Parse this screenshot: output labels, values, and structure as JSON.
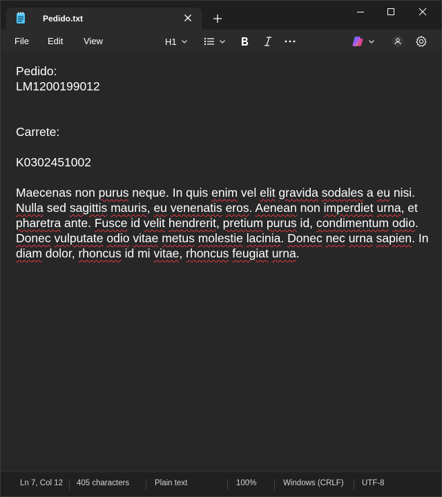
{
  "tab": {
    "title": "Pedido.txt"
  },
  "menu": {
    "file": "File",
    "edit": "Edit",
    "view": "View"
  },
  "toolbar": {
    "heading": "H1"
  },
  "document": {
    "lines": [
      "Pedido:",
      "LM1200199012",
      "",
      "",
      "Carrete:",
      "",
      "K0302451002",
      ""
    ],
    "paragraph_segments": [
      {
        "text": "Maecenas non ",
        "misspelled": false
      },
      {
        "text": "purus",
        "misspelled": true
      },
      {
        "text": " neque. In quis ",
        "misspelled": false
      },
      {
        "text": "enim",
        "misspelled": true
      },
      {
        "text": " vel ",
        "misspelled": false
      },
      {
        "text": "elit",
        "misspelled": true
      },
      {
        "text": " ",
        "misspelled": false
      },
      {
        "text": "gravida",
        "misspelled": true
      },
      {
        "text": " ",
        "misspelled": false
      },
      {
        "text": "sodales",
        "misspelled": true
      },
      {
        "text": " a ",
        "misspelled": false
      },
      {
        "text": "eu",
        "misspelled": true
      },
      {
        "text": " nisi. ",
        "misspelled": false
      },
      {
        "text": "Nulla",
        "misspelled": true
      },
      {
        "text": " sed ",
        "misspelled": false
      },
      {
        "text": "sagittis",
        "misspelled": true
      },
      {
        "text": " ",
        "misspelled": false
      },
      {
        "text": "mauris",
        "misspelled": true
      },
      {
        "text": ", ",
        "misspelled": false
      },
      {
        "text": "eu",
        "misspelled": true
      },
      {
        "text": " ",
        "misspelled": false
      },
      {
        "text": "venenatis",
        "misspelled": true
      },
      {
        "text": " ",
        "misspelled": false
      },
      {
        "text": "eros",
        "misspelled": true
      },
      {
        "text": ". ",
        "misspelled": false
      },
      {
        "text": "Aenean",
        "misspelled": true
      },
      {
        "text": " non ",
        "misspelled": false
      },
      {
        "text": "imperdiet",
        "misspelled": true
      },
      {
        "text": " ",
        "misspelled": false
      },
      {
        "text": "urna",
        "misspelled": true
      },
      {
        "text": ", et ",
        "misspelled": false
      },
      {
        "text": "pharetra",
        "misspelled": true
      },
      {
        "text": " ante. ",
        "misspelled": false
      },
      {
        "text": "Fusce",
        "misspelled": true
      },
      {
        "text": " id ",
        "misspelled": false
      },
      {
        "text": "velit",
        "misspelled": true
      },
      {
        "text": " ",
        "misspelled": false
      },
      {
        "text": "hendrerit",
        "misspelled": true
      },
      {
        "text": ", ",
        "misspelled": false
      },
      {
        "text": "pretium",
        "misspelled": true
      },
      {
        "text": " ",
        "misspelled": false
      },
      {
        "text": "purus",
        "misspelled": true
      },
      {
        "text": " id, ",
        "misspelled": false
      },
      {
        "text": "condimentum",
        "misspelled": true
      },
      {
        "text": " ",
        "misspelled": false
      },
      {
        "text": "odio",
        "misspelled": true
      },
      {
        "text": ". ",
        "misspelled": false
      },
      {
        "text": "Donec",
        "misspelled": true
      },
      {
        "text": " ",
        "misspelled": false
      },
      {
        "text": "vulputate",
        "misspelled": true
      },
      {
        "text": " ",
        "misspelled": false
      },
      {
        "text": "odio",
        "misspelled": true
      },
      {
        "text": " ",
        "misspelled": false
      },
      {
        "text": "vitae",
        "misspelled": true
      },
      {
        "text": " ",
        "misspelled": false
      },
      {
        "text": "metus",
        "misspelled": true
      },
      {
        "text": " ",
        "misspelled": false
      },
      {
        "text": "molestie",
        "misspelled": true
      },
      {
        "text": " ",
        "misspelled": false
      },
      {
        "text": "lacinia",
        "misspelled": true
      },
      {
        "text": ". ",
        "misspelled": false
      },
      {
        "text": "Donec",
        "misspelled": true
      },
      {
        "text": " ",
        "misspelled": false
      },
      {
        "text": "nec",
        "misspelled": true
      },
      {
        "text": " ",
        "misspelled": false
      },
      {
        "text": "urna",
        "misspelled": true
      },
      {
        "text": " ",
        "misspelled": false
      },
      {
        "text": "sapien",
        "misspelled": true
      },
      {
        "text": ". In ",
        "misspelled": false
      },
      {
        "text": "diam",
        "misspelled": true
      },
      {
        "text": " dolor, ",
        "misspelled": false
      },
      {
        "text": "rhoncus",
        "misspelled": true
      },
      {
        "text": " id mi ",
        "misspelled": false
      },
      {
        "text": "vitae",
        "misspelled": true
      },
      {
        "text": ", ",
        "misspelled": false
      },
      {
        "text": "rhoncus",
        "misspelled": true
      },
      {
        "text": " ",
        "misspelled": false
      },
      {
        "text": "feugiat",
        "misspelled": true
      },
      {
        "text": " ",
        "misspelled": false
      },
      {
        "text": "urna",
        "misspelled": true
      },
      {
        "text": ".",
        "misspelled": false
      }
    ]
  },
  "status": {
    "position": "Ln 7, Col 12",
    "characters": "405 characters",
    "format": "Plain text",
    "zoom": "100%",
    "line_ending": "Windows (CRLF)",
    "encoding": "UTF-8"
  },
  "colors": {
    "squiggle": "#e0383e",
    "editor_bg": "#272727",
    "toolbar_bg": "#2b2b2b",
    "copilot_gradient": [
      "#3b82f6",
      "#a855f7",
      "#f59e0b"
    ]
  },
  "icons": {
    "tab": "notepad-icon",
    "close": "close-icon",
    "new_tab": "plus-icon",
    "list": "bulleted-list-icon",
    "bold": "bold-icon",
    "italic": "italic-icon",
    "more": "more-icon",
    "copilot": "copilot-icon",
    "account": "account-icon",
    "settings": "gear-icon"
  }
}
